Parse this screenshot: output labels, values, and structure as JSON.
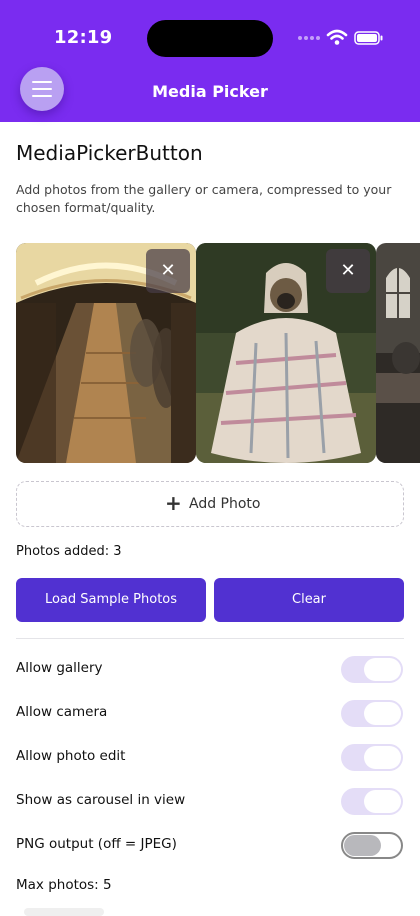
{
  "status_bar": {
    "time": "12:19"
  },
  "app_bar": {
    "title": "Media Picker",
    "menu_icon": "hamburger-icon"
  },
  "content": {
    "section_title": "MediaPickerButton",
    "description": "Add photos from the gallery or camera, compressed to your chosen format/quality.",
    "photos": [
      {
        "subject": "escalator tunnel photo",
        "remove_glyph": "✕"
      },
      {
        "subject": "pug wrapped in blanket photo",
        "remove_glyph": "✕"
      },
      {
        "subject": "room with window photo"
      }
    ],
    "add_photo": {
      "icon": "plus-icon",
      "label": "Add Photo"
    },
    "photos_added": "Photos added: 3",
    "buttons": {
      "load_sample": "Load Sample Photos",
      "clear": "Clear"
    },
    "options": [
      {
        "label": "Allow gallery",
        "on": true
      },
      {
        "label": "Allow camera",
        "on": true
      },
      {
        "label": "Allow photo edit",
        "on": true
      },
      {
        "label": "Show as carousel in view",
        "on": true
      },
      {
        "label": "PNG output (off = JPEG)",
        "on": false
      }
    ],
    "max_photos": "Max photos: 5"
  },
  "colors": {
    "accent": "#7a2cf0",
    "button": "#5131d1",
    "toggle_on_track": "#e4ddf7"
  }
}
